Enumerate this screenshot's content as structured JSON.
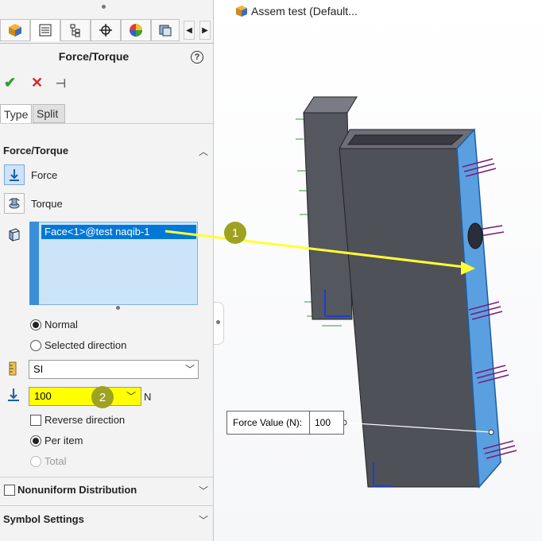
{
  "panel": {
    "tabs": [
      {
        "icon": "part-icon"
      },
      {
        "icon": "property-manager-icon"
      },
      {
        "icon": "configuration-manager-icon"
      },
      {
        "icon": "crosshair-icon"
      },
      {
        "icon": "appearance-icon"
      },
      {
        "icon": "study-icon"
      }
    ],
    "title": "Force/Torque",
    "help_icon": "?",
    "actions": {
      "ok": "✔",
      "cancel": "✕",
      "pin": "⊣"
    },
    "type_tabs": [
      "Type",
      "Split"
    ],
    "force_torque_section": {
      "header": "Force/Torque",
      "force_label": "Force",
      "torque_label": "Torque",
      "selection": "Face<1>@test naqib-1"
    },
    "direction": {
      "normal": "Normal",
      "selected": "Selected direction"
    },
    "unit_system": "SI",
    "force_value": "100",
    "unit_label": "N",
    "reverse_direction": "Reverse direction",
    "per_item": "Per item",
    "total": "Total",
    "nonuniform": "Nonuniform Distribution",
    "symbol_settings": "Symbol Settings",
    "colors": {
      "accent": "#0078d7",
      "ok": "#2e9d2e",
      "cancel": "#d42a2a",
      "highlight": "#ffff00",
      "badge": "#9ea221"
    }
  },
  "viewport": {
    "tree_title": "Assem test  (Default...",
    "badges": [
      "1",
      "2"
    ],
    "callout": {
      "label": "Force Value (N):",
      "value": "100"
    },
    "colors": {
      "part": "#4e5059",
      "face": "#5aa0e0",
      "arrows": "#7a1a7a",
      "leader": "#ffff33"
    }
  }
}
